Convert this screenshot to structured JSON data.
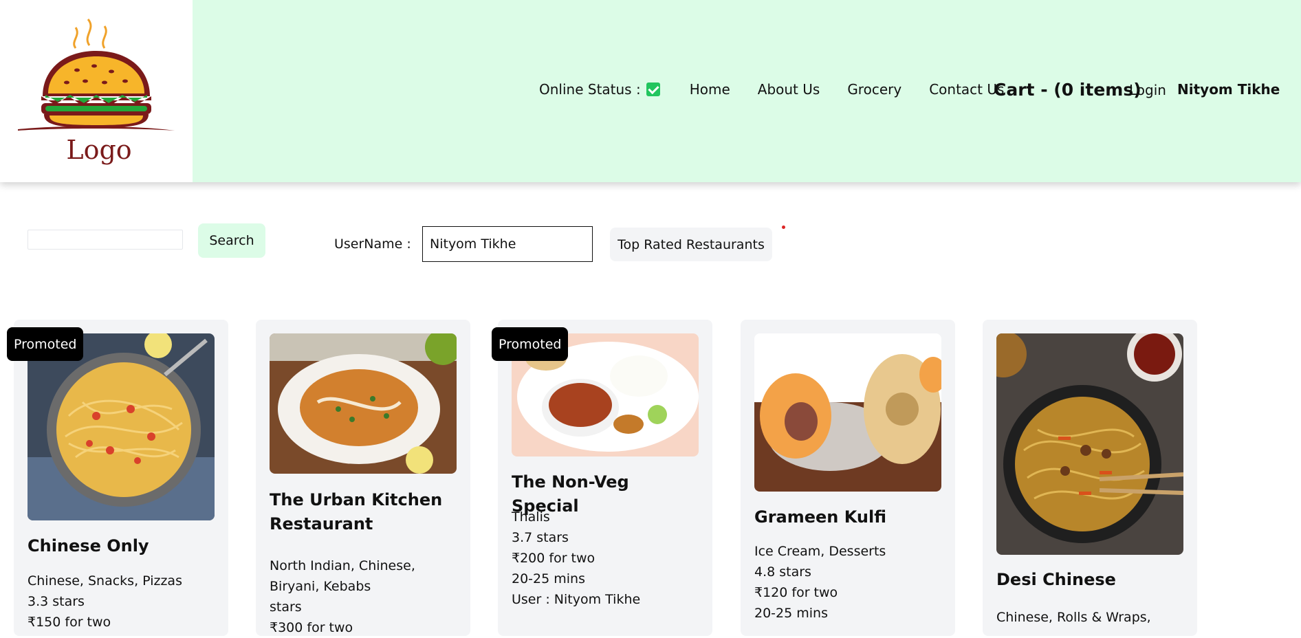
{
  "header": {
    "logo_text": "Logo",
    "online_status_label": "Online Status :",
    "online_status_checked": true,
    "nav": [
      "Home",
      "About Us",
      "Grocery",
      "Contact Us"
    ],
    "cart_label": "Cart - (0 items)",
    "login_label": "Login",
    "user_name": "Nityom Tikhe"
  },
  "toolbar": {
    "search_value": "",
    "search_button": "Search",
    "username_label": "UserName :",
    "username_value": "Nityom Tikhe",
    "top_rated_button": "Top Rated Restaurants"
  },
  "promoted_label": "Promoted",
  "restaurants": [
    {
      "name": "Chinese Only",
      "promoted": true,
      "cuisines": "Chinese, Snacks, Pizzas",
      "rating": "3.3 stars",
      "cost": "₹150 for two",
      "image": "spaghetti-pasta"
    },
    {
      "name": "The Urban Kitchen Restaurant",
      "promoted": false,
      "cuisines": "North Indian, Chinese, Biryani, Kebabs",
      "rating": "stars",
      "cost": "₹300 for two",
      "image": "curry-bowl"
    },
    {
      "name": "The Non-Veg Special",
      "promoted": true,
      "cuisines": "Thalis",
      "rating": "3.7 stars",
      "cost": "₹200 for two",
      "time": "20-25 mins",
      "user": "User : Nityom Tikhe",
      "image": "thali-plate"
    },
    {
      "name": "Grameen Kulfi",
      "promoted": false,
      "cuisines": "Ice Cream, Desserts",
      "rating": "4.8 stars",
      "cost": "₹120 for two",
      "time": "20-25 mins",
      "image": "kulfi"
    },
    {
      "name": "Desi Chinese",
      "promoted": false,
      "cuisines": "Chinese, Rolls & Wraps,",
      "image": "noodles-wok"
    }
  ],
  "colors": {
    "header_bg": "#dcfce7",
    "card_bg": "#f3f4f6",
    "status_check": "#22c55e",
    "badge_bg": "#000000"
  }
}
